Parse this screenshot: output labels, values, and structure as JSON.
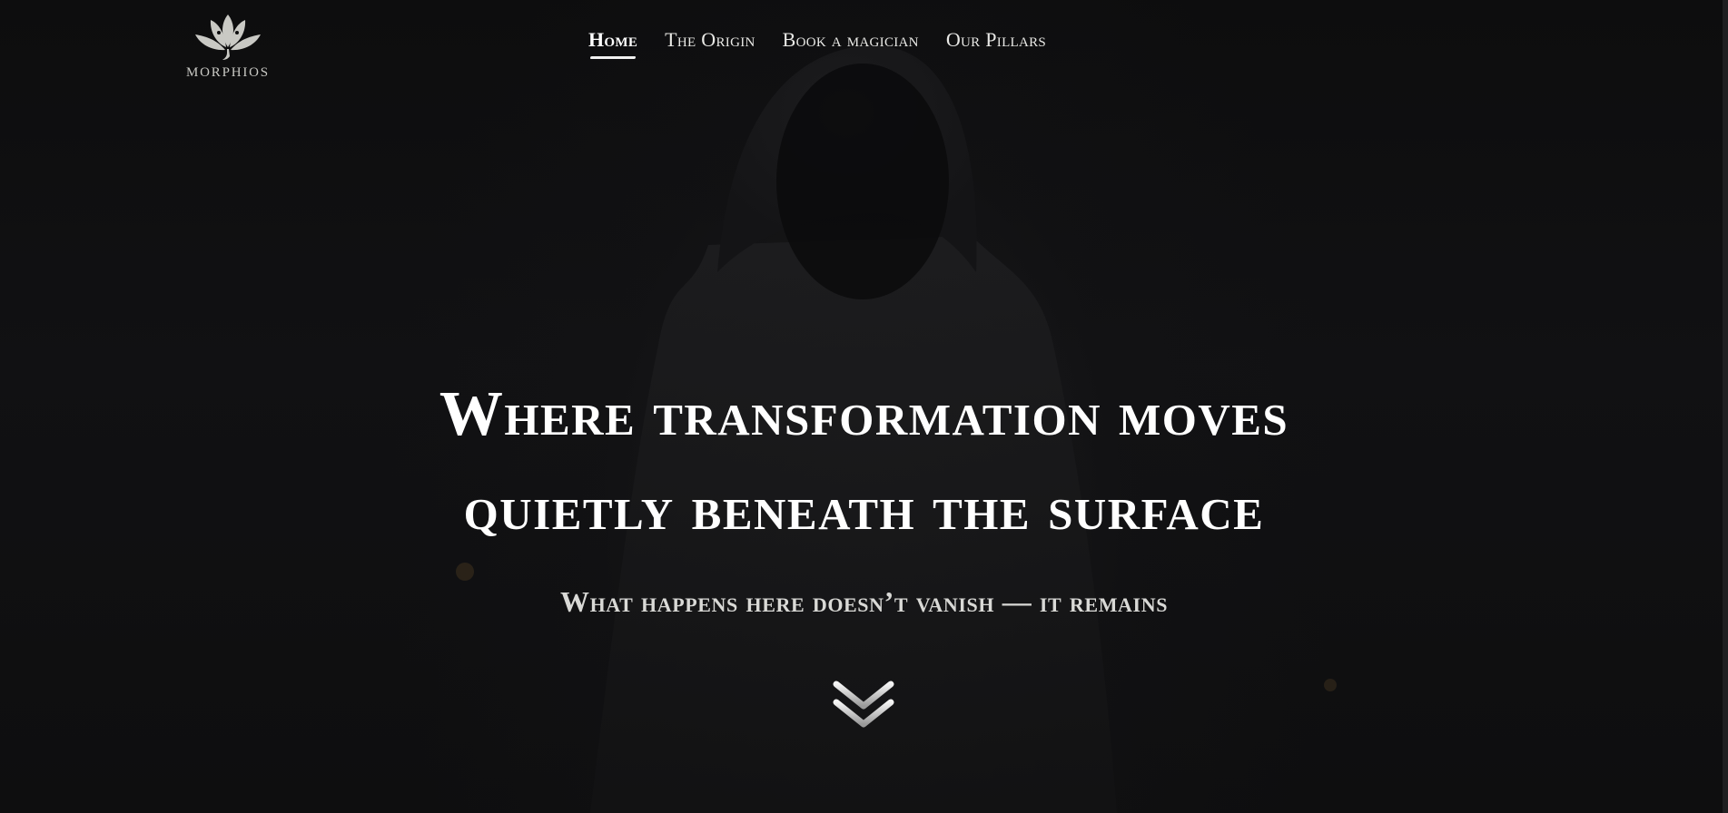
{
  "brand": {
    "name": "MORPHIOS",
    "logo_icon": "lotus-icon"
  },
  "nav": {
    "items": [
      {
        "label": "Home",
        "active": true
      },
      {
        "label": "The Origin",
        "active": false
      },
      {
        "label": "Book a magician",
        "active": false
      },
      {
        "label": "Our Pillars",
        "active": false
      }
    ]
  },
  "hero": {
    "headline_line1": "Where transformation moves",
    "headline_line2": "quietly beneath the surface",
    "subline": "What happens here doesn’t vanish — it remains",
    "scroll_icon": "double-chevron-down-icon"
  },
  "colors": {
    "background": "#0c0c0d",
    "text": "#ffffff",
    "logo": "#c9c9c4"
  }
}
